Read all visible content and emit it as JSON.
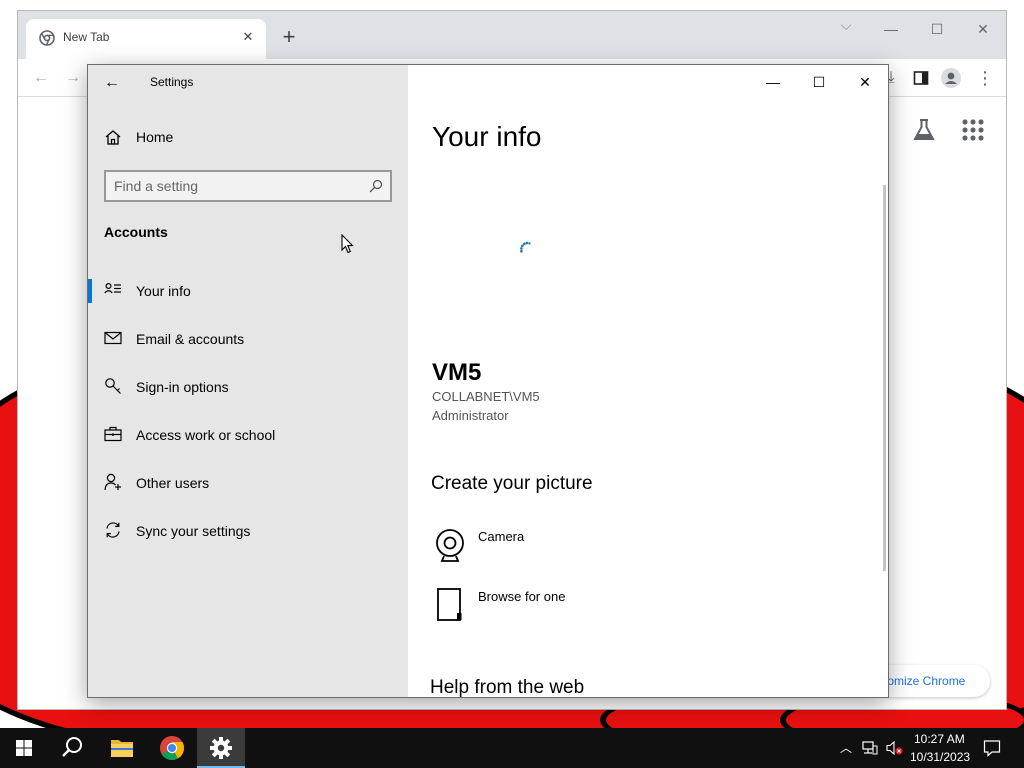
{
  "browser": {
    "tab_title": "New Tab",
    "tab_close_icon": "close-icon",
    "new_tab_icon": "plus-icon",
    "customize_label": "tomize Chrome"
  },
  "settings": {
    "window_title": "Settings",
    "home_label": "Home",
    "search_placeholder": "Find a setting",
    "section_label": "Accounts",
    "nav_items": [
      {
        "label": "Your info",
        "icon": "user-info-icon",
        "active": true
      },
      {
        "label": "Email & accounts",
        "icon": "mail-icon",
        "active": false
      },
      {
        "label": "Sign-in options",
        "icon": "key-icon",
        "active": false
      },
      {
        "label": "Access work or school",
        "icon": "briefcase-icon",
        "active": false
      },
      {
        "label": "Other users",
        "icon": "add-user-icon",
        "active": false
      },
      {
        "label": "Sync your settings",
        "icon": "sync-icon",
        "active": false
      }
    ],
    "page_title": "Your info",
    "user_name": "VM5",
    "user_domain": "COLLABNET\\VM5",
    "user_role": "Administrator",
    "create_heading": "Create your picture",
    "picture_options": [
      {
        "label": "Camera",
        "icon": "camera-icon"
      },
      {
        "label": "Browse for one",
        "icon": "file-icon"
      }
    ],
    "help_heading": "Help from the web"
  },
  "taskbar": {
    "time": "10:27 AM",
    "date": "10/31/2023"
  },
  "colors": {
    "accent": "#0078d7",
    "nav_background": "#e6e6e6",
    "taskbar": "#101010",
    "wallpaper_red": "#e81010"
  }
}
